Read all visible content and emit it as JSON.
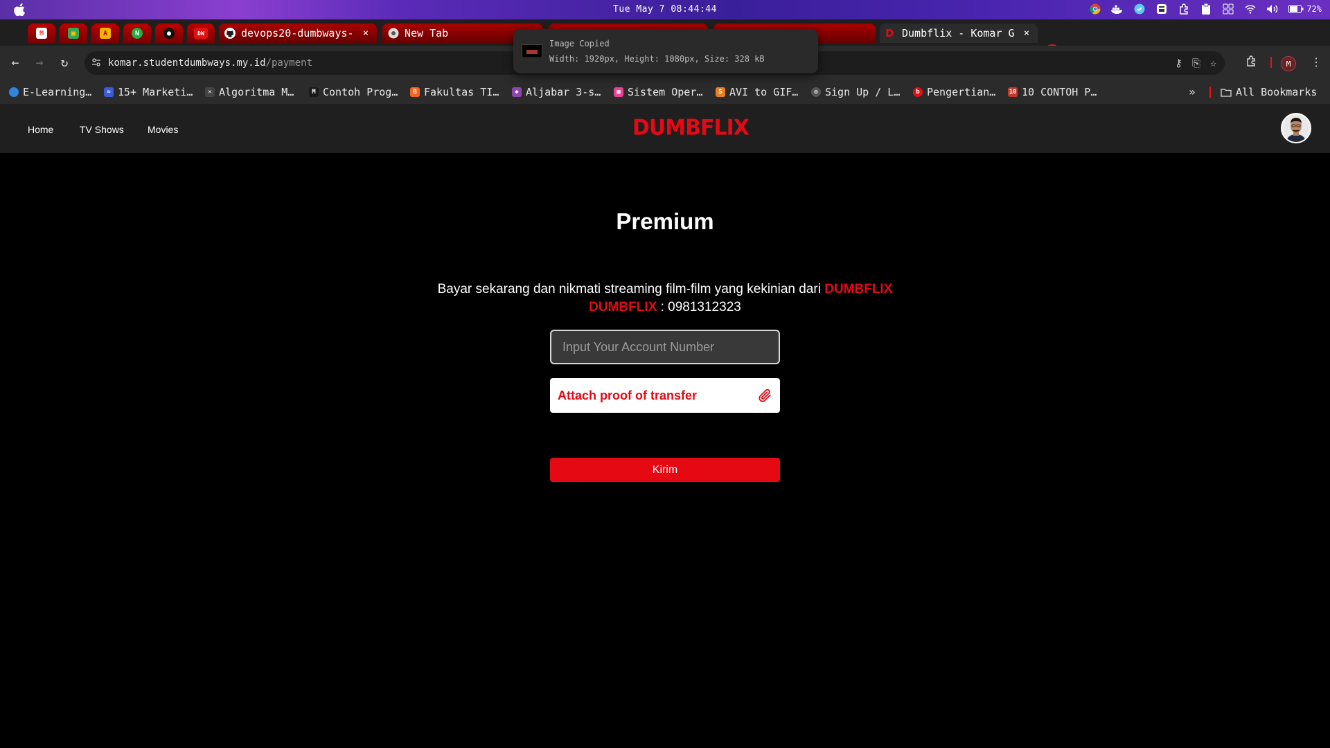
{
  "menubar": {
    "clock": "Tue May 7  08:44:44",
    "battery": "72%"
  },
  "tabs": {
    "mini": [
      {
        "icon": "gmail-icon",
        "color": "#ea4335",
        "glyph": "M"
      },
      {
        "icon": "sheets-icon",
        "color": "#34a853",
        "glyph": "■"
      },
      {
        "icon": "pdf-icon",
        "color": "#f4b400",
        "glyph": "A"
      },
      {
        "icon": "notion-icon",
        "color": "#1fb141",
        "glyph": "N"
      },
      {
        "icon": "ghost-icon",
        "color": "#111111",
        "glyph": "●"
      },
      {
        "icon": "dumbways-icon",
        "color": "#e11111",
        "glyph": "DW"
      }
    ],
    "items": [
      {
        "label": "devops20-dumbways-",
        "close": "×"
      },
      {
        "label": "New Tab",
        "close": ""
      },
      {
        "label": "Dumbflix - Komar G",
        "close": "×"
      }
    ]
  },
  "toast": {
    "title": "Image Copied",
    "detail": "Width: 1920px, Height: 1080px, Size: 328 kB"
  },
  "toolbar": {
    "url_host": "komar.studentdumbways.my.id",
    "url_path": "/payment",
    "profile_initial": "M"
  },
  "bookmarks": {
    "items": [
      {
        "label": "E-Learning…",
        "color": "#2e86de"
      },
      {
        "label": "15+ Marketi…",
        "color": "#3b5bdb"
      },
      {
        "label": "Algoritma M…",
        "color": "#444444"
      },
      {
        "label": "Contoh Prog…",
        "color": "#1a1a1a"
      },
      {
        "label": "Fakultas TI…",
        "color": "#f26522"
      },
      {
        "label": "Aljabar 3-s…",
        "color": "#8e44ad"
      },
      {
        "label": "Sistem Oper…",
        "color": "#e84393"
      },
      {
        "label": "AVI to GIF…",
        "color": "#e67e22"
      },
      {
        "label": "Sign Up / L…",
        "color": "#555555"
      },
      {
        "label": "Pengertian…",
        "color": "#e11111"
      },
      {
        "label": "10 CONTOH P…",
        "color": "#c0392b"
      }
    ],
    "all": "All Bookmarks"
  },
  "app": {
    "nav": {
      "home": "Home",
      "tv": "TV Shows",
      "movies": "Movies"
    },
    "logo": "DUMBFLIX",
    "title": "Premium",
    "desc_text": "Bayar sekarang dan nikmati streaming film-film yang kekinian dari",
    "brand": "DUMBFLIX",
    "brand2": "DUMBFLIX",
    "account_sep": " : ",
    "account_number": "0981312323",
    "input_placeholder": "Input Your Account Number",
    "attach_label": "Attach proof of transfer",
    "submit_label": "Kirim",
    "accent": "#e50914"
  }
}
